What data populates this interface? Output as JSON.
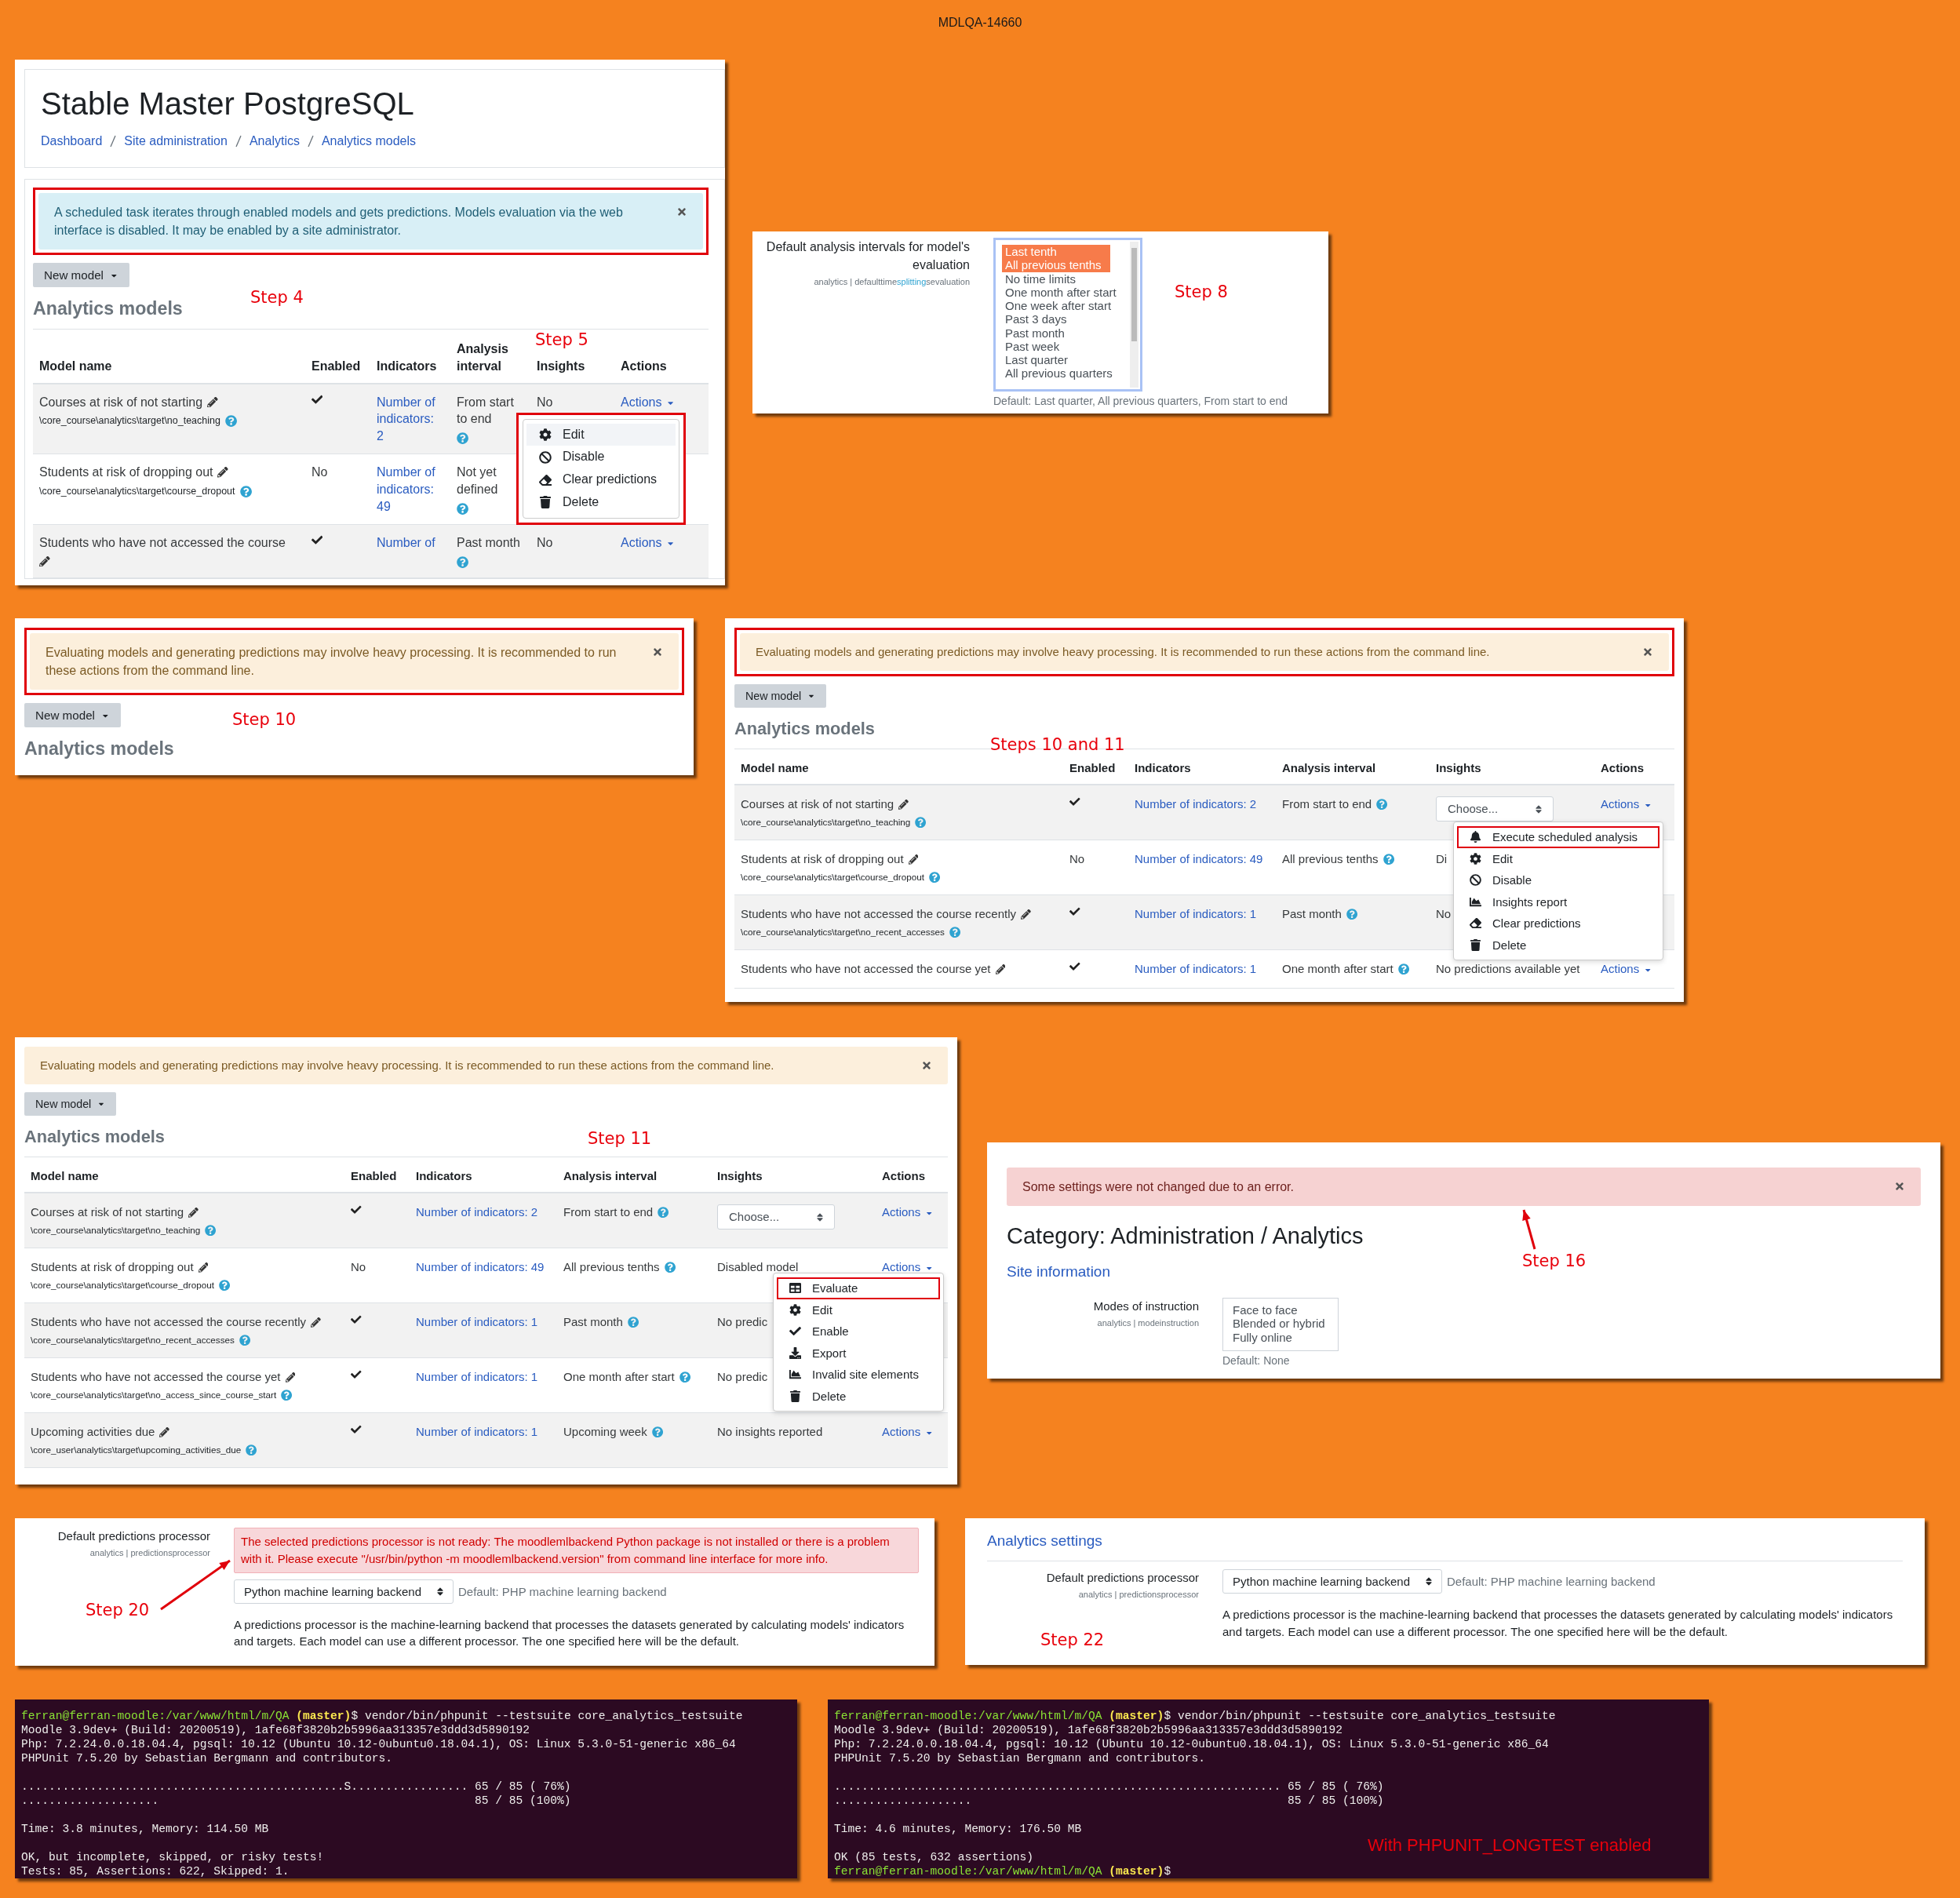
{
  "caption": "MDLQA-14660",
  "panels": [
    {
      "kind": "models",
      "site_title": "Stable Master PostgreSQL",
      "breadcrumbs": [
        "Dashboard",
        "Site administration",
        "Analytics",
        "Analytics models"
      ],
      "notice": {
        "kind": "info",
        "annotated": true,
        "text": "A scheduled task iterates through enabled models and gets predictions. Models evaluation via the web interface is disabled. It may be enabled by a site administrator."
      },
      "new_model": "New model",
      "step": "Step 4",
      "heading": "Analytics models",
      "columns": [
        "Model name",
        "Enabled",
        "Indicators",
        "Analysis interval",
        "Insights",
        "Actions"
      ],
      "rows": [
        {
          "name": "Courses at risk of not starting",
          "target": "\\core_course\\analytics\\target\\no_teaching",
          "enabled": true,
          "indicators": "Number of indicators: 2",
          "interval": "From start to end",
          "insights": {
            "kind": "text",
            "text": "No"
          },
          "actions": "Actions",
          "menu": {
            "step": "Step 5",
            "annotated": true,
            "items": [
              {
                "kind": "edit",
                "label": "Edit",
                "highlighted": true,
                "annotated": false
              },
              {
                "kind": "disable",
                "label": "Disable",
                "highlighted": false,
                "annotated": false
              },
              {
                "kind": "clear",
                "label": "Clear predictions",
                "highlighted": false,
                "annotated": false
              },
              {
                "kind": "delete",
                "label": "Delete",
                "highlighted": false,
                "annotated": false
              }
            ]
          }
        },
        {
          "name": "Students at risk of dropping out",
          "target": "\\core_course\\analytics\\target\\course_dropout",
          "enabled": false,
          "enabled_label": "No",
          "indicators": "Number of indicators: 49",
          "interval": "Not yet defined"
        },
        {
          "name": "Students who have not accessed the course",
          "enabled": true,
          "indicators": "Number of",
          "interval": "Past month",
          "insights": {
            "kind": "text",
            "text": "No"
          },
          "actions": "Actions"
        }
      ]
    },
    {
      "kind": "multiselect",
      "label": "Default analysis intervals for model's evaluation",
      "setting_id": [
        {
          "text": "analytics | defaulttime",
          "highlight": false
        },
        {
          "text": "splitting",
          "highlight": true
        },
        {
          "text": "sevaluation",
          "highlight": false
        }
      ],
      "options": [
        {
          "label": "Last tenth",
          "selected": true
        },
        {
          "label": "All previous tenths",
          "selected": true
        },
        {
          "label": "No time limits",
          "selected": false
        },
        {
          "label": "One month after start",
          "selected": false
        },
        {
          "label": "One week after start",
          "selected": false
        },
        {
          "label": "Past 3 days",
          "selected": false
        },
        {
          "label": "Past month",
          "selected": false
        },
        {
          "label": "Past week",
          "selected": false
        },
        {
          "label": "Last quarter",
          "selected": false
        },
        {
          "label": "All previous quarters",
          "selected": false
        }
      ],
      "default": "Default: Last quarter, All previous quarters, From start to end",
      "step": "Step 8"
    },
    {
      "kind": "models",
      "notice": {
        "kind": "warning",
        "annotated": true,
        "text": "Evaluating models and generating predictions may involve heavy processing. It is recommended to run these actions from the command line."
      },
      "new_model": "New model",
      "step": "Step 10",
      "heading": "Analytics models"
    },
    {
      "kind": "models",
      "notice": {
        "kind": "warning",
        "annotated": true,
        "text": "Evaluating models and generating predictions may involve heavy processing. It is recommended to run these actions from the command line."
      },
      "new_model": "New model",
      "step": "Steps 10 and 11",
      "heading": "Analytics models",
      "columns": [
        "Model name",
        "Enabled",
        "Indicators",
        "Analysis interval",
        "Insights",
        "Actions"
      ],
      "rows": [
        {
          "name": "Courses at risk of not starting",
          "target": "\\core_course\\analytics\\target\\no_teaching",
          "enabled": true,
          "indicators": "Number of indicators: 2",
          "interval": "From start to end",
          "insights": {
            "kind": "select",
            "value": "Choose..."
          },
          "actions": "Actions",
          "menu": {
            "annotated": false,
            "items": [
              {
                "kind": "execute",
                "label": "Execute scheduled analysis",
                "highlighted": false,
                "annotated": true
              },
              {
                "kind": "edit",
                "label": "Edit",
                "highlighted": false,
                "annotated": false
              },
              {
                "kind": "disable",
                "label": "Disable",
                "highlighted": false,
                "annotated": false
              },
              {
                "kind": "insights",
                "label": "Insights report",
                "highlighted": false,
                "annotated": false
              },
              {
                "kind": "clear",
                "label": "Clear predictions",
                "highlighted": false,
                "annotated": false
              },
              {
                "kind": "delete",
                "label": "Delete",
                "highlighted": false,
                "annotated": false
              }
            ]
          }
        },
        {
          "name": "Students at risk of dropping out",
          "target": "\\core_course\\analytics\\target\\course_dropout",
          "enabled": false,
          "enabled_label": "No",
          "indicators": "Number of indicators: 49",
          "interval": "All previous tenths",
          "insights": {
            "kind": "text",
            "text": "Di"
          }
        },
        {
          "name": "Students who have not accessed the course recently",
          "target": "\\core_course\\analytics\\target\\no_recent_accesses",
          "enabled": true,
          "indicators": "Number of indicators: 1",
          "interval": "Past month",
          "insights": {
            "kind": "text",
            "text": "No"
          }
        },
        {
          "name": "Students who have not accessed the course yet",
          "enabled": true,
          "indicators": "Number of indicators: 1",
          "interval": "One month after start",
          "insights": {
            "kind": "text",
            "text": "No predictions available yet"
          },
          "actions": "Actions"
        }
      ]
    },
    {
      "kind": "models",
      "notice": {
        "kind": "warning",
        "annotated": false,
        "text": "Evaluating models and generating predictions may involve heavy processing. It is recommended to run these actions from the command line."
      },
      "new_model": "New model",
      "step": "Step 11",
      "heading": "Analytics models",
      "columns": [
        "Model name",
        "Enabled",
        "Indicators",
        "Analysis interval",
        "Insights",
        "Actions"
      ],
      "rows": [
        {
          "name": "Courses at risk of not starting",
          "target": "\\core_course\\analytics\\target\\no_teaching",
          "enabled": true,
          "indicators": "Number of indicators: 2",
          "interval": "From start to end",
          "insights": {
            "kind": "select",
            "value": "Choose..."
          },
          "actions": "Actions"
        },
        {
          "name": "Students at risk of dropping out",
          "target": "\\core_course\\analytics\\target\\course_dropout",
          "enabled": false,
          "enabled_label": "No",
          "indicators": "Number of indicators: 49",
          "interval": "All previous tenths",
          "insights": {
            "kind": "text",
            "text": "Disabled model"
          },
          "actions": "Actions",
          "menu": {
            "annotated": false,
            "items": [
              {
                "kind": "evaluate",
                "label": "Evaluate",
                "highlighted": false,
                "annotated": true
              },
              {
                "kind": "edit",
                "label": "Edit",
                "highlighted": false,
                "annotated": false
              },
              {
                "kind": "enable",
                "label": "Enable",
                "highlighted": false,
                "annotated": false
              },
              {
                "kind": "export",
                "label": "Export",
                "highlighted": false,
                "annotated": false
              },
              {
                "kind": "insights",
                "label": "Invalid site elements",
                "highlighted": false,
                "annotated": false
              },
              {
                "kind": "delete",
                "label": "Delete",
                "highlighted": false,
                "annotated": false
              }
            ]
          }
        },
        {
          "name": "Students who have not accessed the course recently",
          "target": "\\core_course\\analytics\\target\\no_recent_accesses",
          "enabled": true,
          "indicators": "Number of indicators: 1",
          "interval": "Past month",
          "insights": {
            "kind": "text",
            "text": "No predic"
          }
        },
        {
          "name": "Students who have not accessed the course yet",
          "target": "\\core_course\\analytics\\target\\no_access_since_course_start",
          "enabled": true,
          "indicators": "Number of indicators: 1",
          "interval": "One month after start",
          "insights": {
            "kind": "text",
            "text": "No predic"
          }
        },
        {
          "name": "Upcoming activities due",
          "target": "\\core_user\\analytics\\target\\upcoming_activities_due",
          "enabled": true,
          "indicators": "Number of indicators: 1",
          "interval": "Upcoming week",
          "insights": {
            "kind": "text",
            "text": "No insights reported"
          },
          "actions": "Actions"
        }
      ]
    },
    {
      "kind": "settings",
      "notice": {
        "kind": "error",
        "annotated": false,
        "text": "Some settings were not changed due to an error."
      },
      "heading": "Category: Administration / Analytics",
      "section": "Site information",
      "label": "Modes of instruction",
      "setting_id": [
        {
          "text": "analytics | modeinstruction",
          "highlight": false
        }
      ],
      "options": [
        {
          "label": "Face to face",
          "selected": false
        },
        {
          "label": "Blended or hybrid",
          "selected": false
        },
        {
          "label": "Fully online",
          "selected": false
        }
      ],
      "default": "Default: None",
      "step": "Step 16"
    },
    {
      "kind": "processor",
      "label": "Default predictions processor",
      "setting_id": [
        {
          "text": "analytics | predictionsprocessor",
          "highlight": false
        }
      ],
      "error": "The selected predictions processor is not ready: The moodlemlbackend Python package is not installed or there is a problem with it. Please execute \"/usr/bin/python -m moodlemlbackend.version\" from command line interface for more info.",
      "select": "Python machine learning backend",
      "default": "Default: PHP machine learning backend",
      "description": "A predictions processor is the machine-learning backend that processes the datasets generated by calculating models' indicators and targets. Each model can use a different processor. The one specified here will be the default.",
      "step": "Step 20"
    },
    {
      "kind": "processor",
      "section": "Analytics settings",
      "label": "Default predictions processor",
      "setting_id": [
        {
          "text": "analytics | predictionsprocessor",
          "highlight": false
        }
      ],
      "select": "Python machine learning backend",
      "default": "Default: PHP machine learning backend",
      "description": "A predictions processor is the machine-learning backend that processes the datasets generated by calculating models' indicators and targets. Each model can use a different processor. The one specified here will be the default.",
      "step": "Step 22"
    },
    {
      "kind": "terminal",
      "lines": [
        {
          "kind": "prompt",
          "user": "ferran@ferran-moodle:/var/www/html/m/QA",
          "branch": " (master)",
          "command": "$ vendor/bin/phpunit --testsuite core_analytics_testsuite"
        },
        {
          "kind": "output",
          "text": "Moodle 3.9dev+ (Build: 20200519), 1afe68f3820b2b5996aa313357e3ddd3d5890192"
        },
        {
          "kind": "output",
          "text": "Php: 7.2.24.0.0.18.04.4, pgsql: 10.12 (Ubuntu 10.12-0ubuntu0.18.04.1), OS: Linux 5.3.0-51-generic x86_64"
        },
        {
          "kind": "output",
          "text": "PHPUnit 7.5.20 by Sebastian Bergmann and contributors."
        },
        {
          "kind": "blank"
        },
        {
          "kind": "output",
          "text": "...............................................S................. 65 / 85 ( 76%)"
        },
        {
          "kind": "output",
          "text": "....................                                              85 / 85 (100%)"
        },
        {
          "kind": "blank"
        },
        {
          "kind": "output",
          "text": "Time: 3.8 minutes, Memory: 114.50 MB"
        },
        {
          "kind": "blank"
        },
        {
          "kind": "output",
          "text": "OK, but incomplete, skipped, or risky tests!"
        },
        {
          "kind": "output",
          "text": "Tests: 85, Assertions: 622, Skipped: 1."
        }
      ]
    },
    {
      "kind": "terminal",
      "note": "With PHPUNIT_LONGTEST enabled",
      "lines": [
        {
          "kind": "prompt",
          "user": "ferran@ferran-moodle:/var/www/html/m/QA",
          "branch": " (master)",
          "command": "$ vendor/bin/phpunit --testsuite core_analytics_testsuite"
        },
        {
          "kind": "output",
          "text": "Moodle 3.9dev+ (Build: 20200519), 1afe68f3820b2b5996aa313357e3ddd3d5890192"
        },
        {
          "kind": "output",
          "text": "Php: 7.2.24.0.0.18.04.4, pgsql: 10.12 (Ubuntu 10.12-0ubuntu0.18.04.1), OS: Linux 5.3.0-51-generic x86_64"
        },
        {
          "kind": "output",
          "text": "PHPUnit 7.5.20 by Sebastian Bergmann and contributors."
        },
        {
          "kind": "blank"
        },
        {
          "kind": "output",
          "text": "................................................................. 65 / 85 ( 76%)"
        },
        {
          "kind": "output",
          "text": "....................                                              85 / 85 (100%)"
        },
        {
          "kind": "blank"
        },
        {
          "kind": "output",
          "text": "Time: 4.6 minutes, Memory: 176.50 MB"
        },
        {
          "kind": "blank"
        },
        {
          "kind": "output",
          "text": "OK (85 tests, 632 assertions)"
        },
        {
          "kind": "prompt",
          "user": "ferran@ferran-moodle:/var/www/html/m/QA",
          "branch": " (master)",
          "command": "$"
        }
      ]
    }
  ]
}
